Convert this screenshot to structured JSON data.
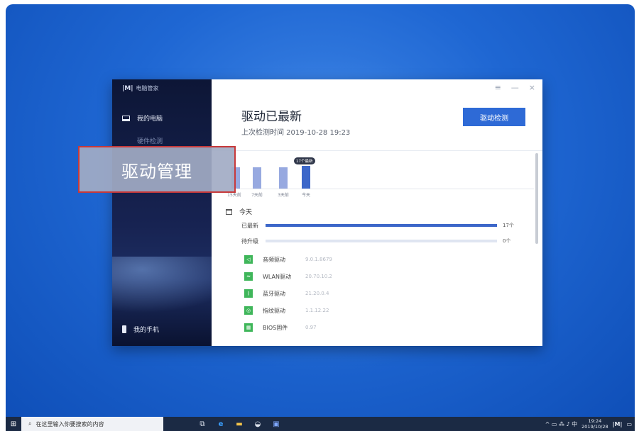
{
  "app": {
    "brand": "电脑管家",
    "brand_logo": "|M|",
    "sidebar_items": [
      {
        "label": "我的电脑",
        "icon": "laptop-icon"
      },
      {
        "label": "硬件检测",
        "icon": ""
      }
    ],
    "sidebar_bottom": {
      "label": "我的手机",
      "icon": "phone-icon"
    },
    "window_controls": [
      "≡",
      "—",
      "×"
    ],
    "title": "驱动已最新",
    "subtitle": "上次检测时间 2019-10-28 19:23",
    "check_button": "驱动检测",
    "chart": {
      "labels": [
        "15天前",
        "7天前",
        "3天前",
        "今天"
      ],
      "bubble": "17个最新"
    },
    "today_label": "今天",
    "progress": [
      {
        "label": "已最新",
        "count": "17个",
        "fraction": 1.0
      },
      {
        "label": "待升级",
        "count": "0个",
        "fraction": 0.0
      }
    ],
    "drivers": [
      {
        "name": "音频驱动",
        "version": "9.0.1.8679",
        "icon": "speaker-icon"
      },
      {
        "name": "WLAN驱动",
        "version": "20.70.10.2",
        "icon": "wifi-icon"
      },
      {
        "name": "蓝牙驱动",
        "version": "21.20.0.4",
        "icon": "bluetooth-icon"
      },
      {
        "name": "指纹驱动",
        "version": "1.1.12.22",
        "icon": "fingerprint-icon"
      },
      {
        "name": "BIOS固件",
        "version": "0.97",
        "icon": "chip-icon"
      }
    ]
  },
  "callout": "驱动管理",
  "taskbar": {
    "search_placeholder": "在这里输入你要搜索的内容",
    "tray_text": "^ ▭ ⁂ ♪ 中",
    "clock_time": "19:24",
    "clock_date": "2019/10/28",
    "ime": "中"
  }
}
